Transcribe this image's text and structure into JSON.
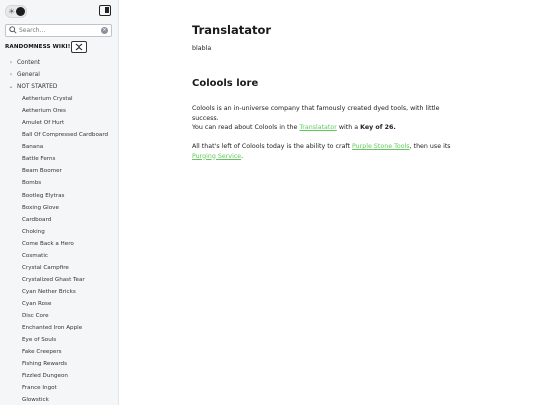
{
  "sidebar": {
    "search": {
      "placeholder": "Search..."
    },
    "wiki_title": "RANDOMNESS WIKI!",
    "tree": [
      {
        "label": "Content",
        "expanded": false
      },
      {
        "label": "General",
        "expanded": false
      },
      {
        "label": "NOT STARTED",
        "expanded": true
      }
    ],
    "items": [
      "Aetherium Crystal",
      "Aetherium Ores",
      "Amulet Of Hurt",
      "Ball Of Compressed Cardboard",
      "Banana",
      "Battle Ferns",
      "Beam Boomer",
      "Bombs",
      "Bootleg Elytras",
      "Boxing Glove",
      "Cardboard",
      "Choking",
      "Come Back a Hero",
      "Cosmatic",
      "Crystal Campfire",
      "Crystalized Ghast Tear",
      "Cyan Nether Bricks",
      "Cyan Rose",
      "Disc Core",
      "Enchanted Iron Apple",
      "Eye of Souls",
      "Fake Creepers",
      "Fishing Rewards",
      "Fizzled Dungeon",
      "France Ingot",
      "Glowstick"
    ]
  },
  "main": {
    "h1": "Translatator",
    "p1": "blabla",
    "h2": "Colools lore",
    "para1": {
      "line1": "Colools is an in-universe company that famously created dyed tools, with little",
      "line2": "success.",
      "line3_pre": "You can read about Colools in the ",
      "line3_link": "Translatator",
      "line3_mid": " with a ",
      "line3_bold": "Key of 26."
    },
    "para2": {
      "pre": "All that's left of Colools today is the ability to craft ",
      "link1": "Purple Stone Tools",
      "mid": ", then use its",
      "link2": "Purging Service",
      "post": "."
    }
  }
}
